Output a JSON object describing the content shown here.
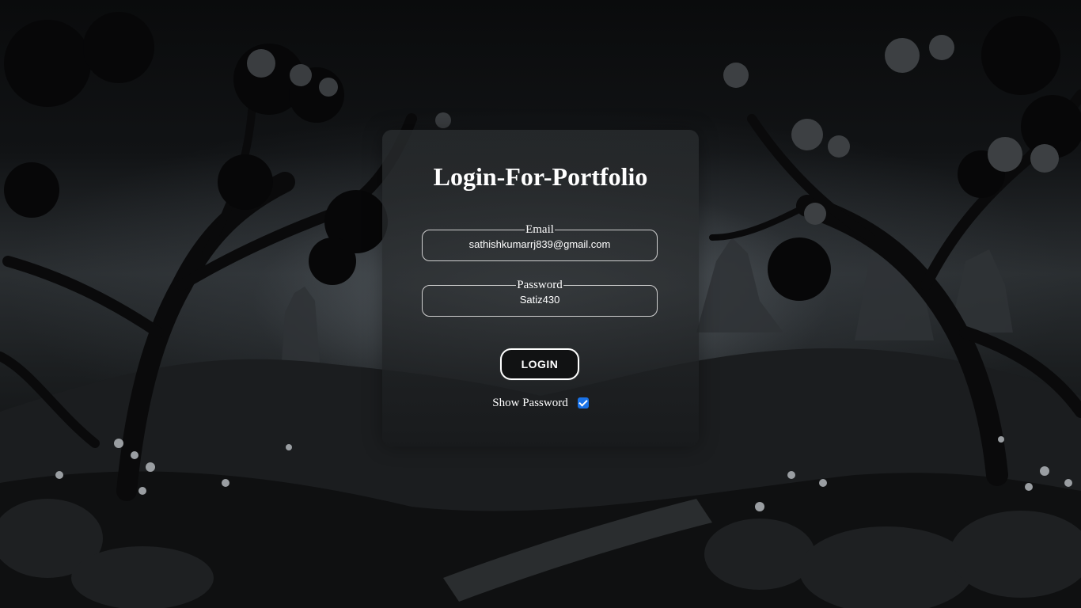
{
  "page": {
    "title": "Login-For-Portfolio"
  },
  "form": {
    "email_label": "Email",
    "email_value": "sathishkumarrj839@gmail.com",
    "password_label": "Password",
    "password_value": "Satiz430",
    "login_label": "LOGIN",
    "show_password_label": "Show Password",
    "show_password_checked": true
  },
  "colors": {
    "checkbox_accent": "#1a73e8",
    "text": "#ffffff",
    "field_border": "#cfcfcf",
    "button_bg": "#111213"
  }
}
